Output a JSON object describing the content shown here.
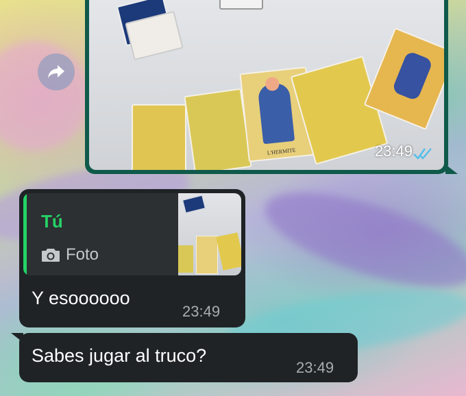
{
  "photo_message": {
    "time": "23:49",
    "status_icon": "double-check-icon",
    "status_color": "#53bdeb",
    "card_label": "L'HERMITE"
  },
  "forward_icon": "forward-arrow-icon",
  "reply_message": {
    "quoted_author": "Tú",
    "quoted_type_icon": "camera-icon",
    "quoted_type_label": "Foto",
    "text": "Y esoooooo",
    "time": "23:49"
  },
  "second_message": {
    "text": "Sabes jugar al truco?",
    "time": "23:49"
  },
  "colors": {
    "bubble_dark": "#1f2326",
    "accent_green": "#25d366",
    "photo_border": "#0f5a4a"
  }
}
